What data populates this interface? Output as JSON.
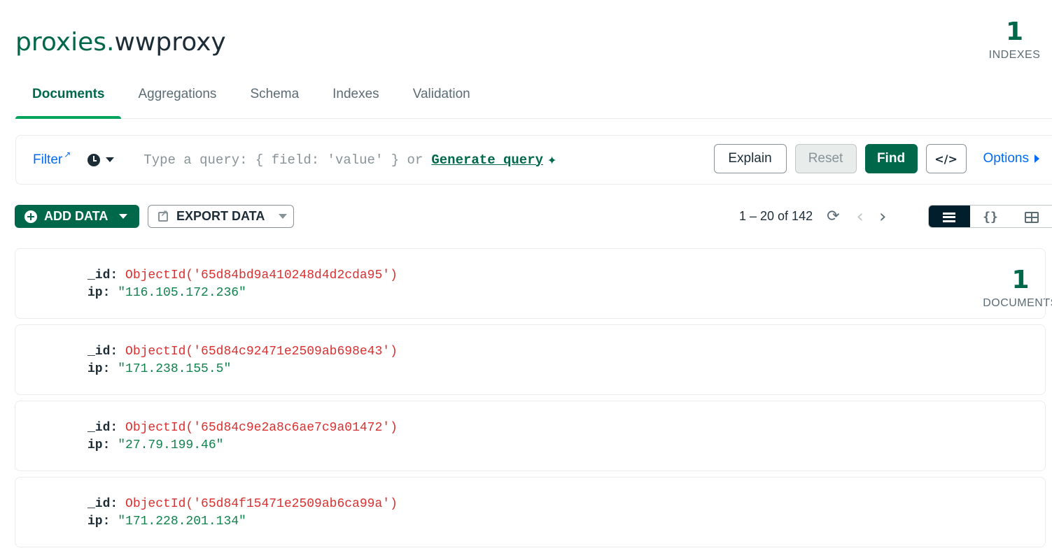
{
  "header": {
    "db_name": "proxies",
    "separator": ".",
    "collection_name": "wwproxy"
  },
  "stats": {
    "documents_count": "1",
    "documents_label": "DOCUMENTS",
    "indexes_count": "1",
    "indexes_label": "INDEXES"
  },
  "tabs": [
    {
      "label": "Documents",
      "active": true
    },
    {
      "label": "Aggregations"
    },
    {
      "label": "Schema"
    },
    {
      "label": "Indexes"
    },
    {
      "label": "Validation"
    }
  ],
  "querybar": {
    "filter_label": "Filter",
    "placeholder": "Type a query: { field: 'value' } or",
    "generate_link": "Generate query",
    "explain_label": "Explain",
    "reset_label": "Reset",
    "find_label": "Find",
    "code_label": "</>",
    "options_label": "Options"
  },
  "toolbar": {
    "add_data_label": "ADD DATA",
    "export_data_label": "EXPORT DATA",
    "pagination_text": "1 – 20 of 142",
    "view_json_label": "{}"
  },
  "documents": [
    {
      "id_key": "_id",
      "id_value": "ObjectId('65d84bd9a410248d4d2cda95')",
      "ip_key": "ip",
      "ip_value": "\"116.105.172.236\""
    },
    {
      "id_key": "_id",
      "id_value": "ObjectId('65d84c92471e2509ab698e43')",
      "ip_key": "ip",
      "ip_value": "\"171.238.155.5\""
    },
    {
      "id_key": "_id",
      "id_value": "ObjectId('65d84c9e2a8c6ae7c9a01472')",
      "ip_key": "ip",
      "ip_value": "\"27.79.199.46\""
    },
    {
      "id_key": "_id",
      "id_value": "ObjectId('65d84f15471e2509ab6ca99a')",
      "ip_key": "ip",
      "ip_value": "\"171.228.201.134\""
    }
  ],
  "colors": {
    "brand_green": "#00684a",
    "accent_green": "#00a35c",
    "link_blue": "#016bf8",
    "objectid_red": "#db3030",
    "string_green": "#12824d"
  }
}
